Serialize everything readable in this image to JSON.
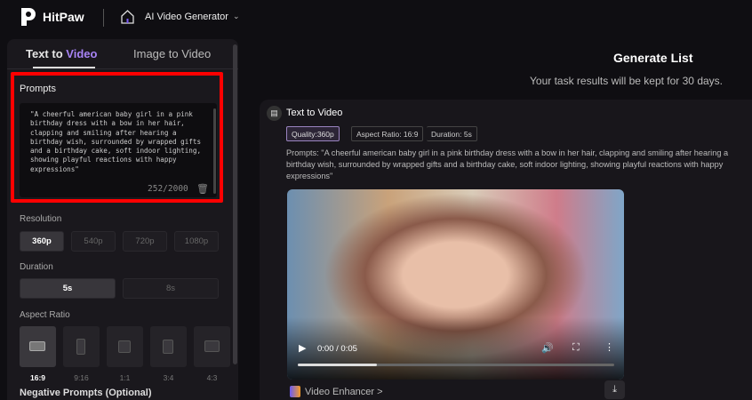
{
  "header": {
    "brand": "HitPaw",
    "app": "AI Video Generator"
  },
  "tabs": {
    "text_to_video_a": "Text to ",
    "text_to_video_b": "Video",
    "image_to_video": "Image to Video"
  },
  "prompts": {
    "label": "Prompts",
    "value": "\"A cheerful american baby girl in a pink birthday dress with a bow in her hair, clapping and smiling after hearing a birthday wish, surrounded by wrapped gifts and a birthday cake, soft indoor lighting, showing playful reactions with happy expressions\"",
    "count": "252/2000"
  },
  "resolution": {
    "label": "Resolution",
    "options": [
      "360p",
      "540p",
      "720p",
      "1080p"
    ],
    "selected": "360p"
  },
  "duration": {
    "label": "Duration",
    "options": [
      "5s",
      "8s"
    ],
    "selected": "5s"
  },
  "aspect": {
    "label": "Aspect Ratio",
    "options": [
      "16:9",
      "9:16",
      "1:1",
      "3:4",
      "4:3"
    ],
    "selected": "16:9"
  },
  "negative": {
    "label": "Negative Prompts (Optional)"
  },
  "generate_list": {
    "title": "Generate List",
    "subtitle": "Your task results will be kept for 30 days."
  },
  "task": {
    "title": "Text to Video",
    "chips": [
      "Quality:360p",
      "Aspect Ratio: 16:9",
      "Duration: 5s"
    ],
    "prompt_line1": "Prompts:  \"A cheerful american baby girl in a pink birthday dress with a bow in her hair, clapping and smiling after hearing a birthday wish, surrounded by",
    "prompt_line2": "wrapped gifts and a birthday cake, soft indoor lighting, showing playful reactions with happy expressions\"",
    "video": {
      "time": "0:00 / 0:05",
      "buffered_percent": 25
    },
    "enhancer": "Video Enhancer >"
  },
  "colors": {
    "accent": "#a783f5",
    "highlight_box": "#ff0000"
  }
}
